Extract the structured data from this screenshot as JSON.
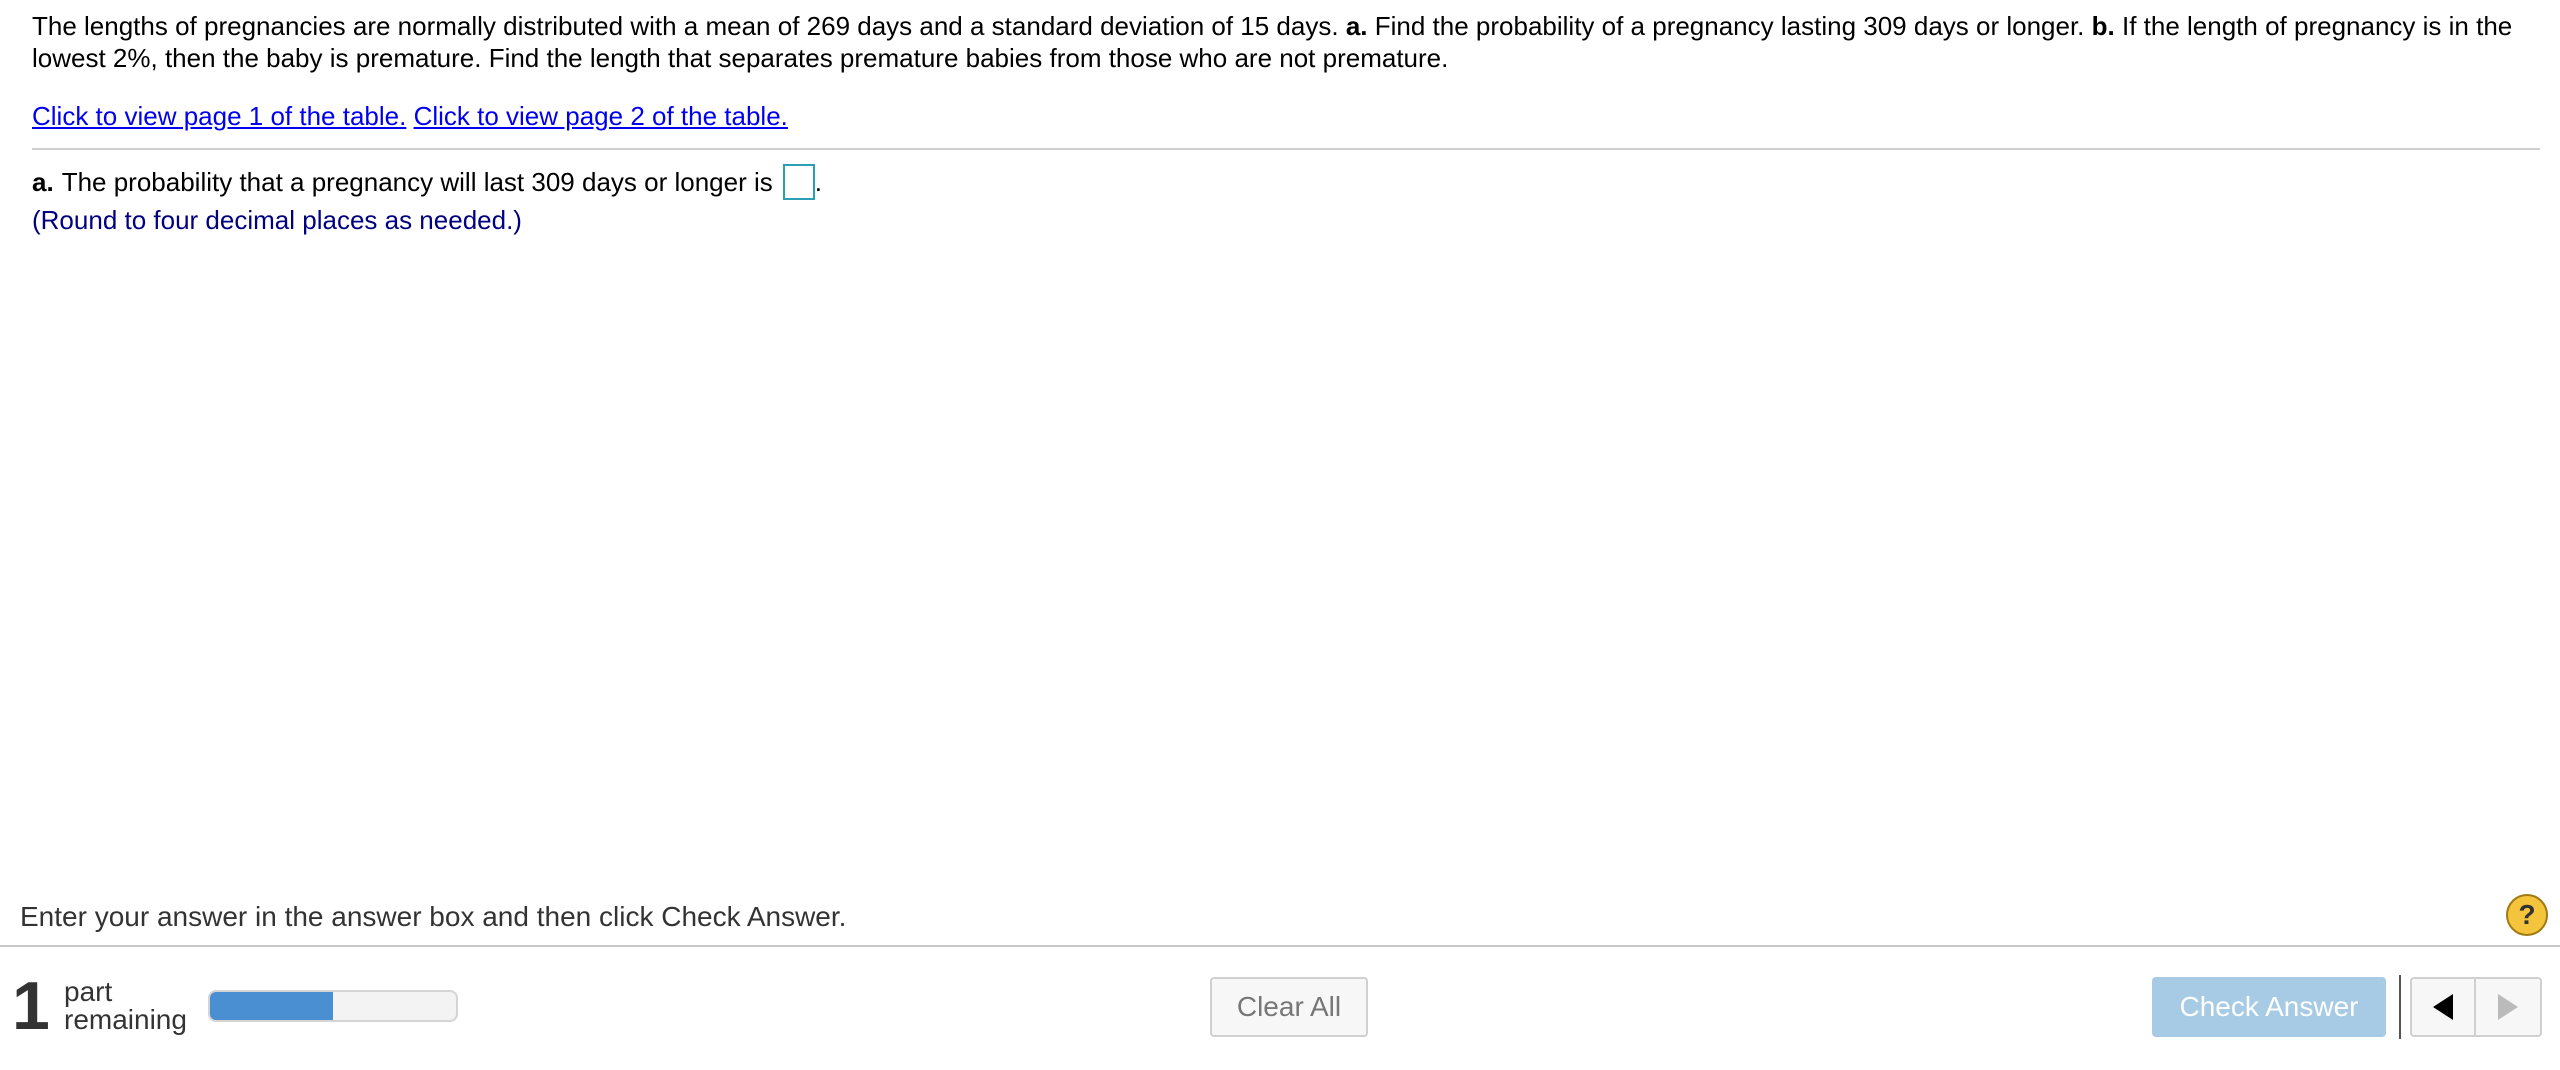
{
  "question": {
    "part1": "The lengths of pregnancies are normally distributed with a mean of 269 days and a standard deviation of 15 days.",
    "label_a": "a.",
    "part2": "Find the probability of a pregnancy lasting 309 days or longer.",
    "label_b": "b.",
    "part3": "If the length of pregnancy is in the lowest 2%, then the baby is premature. Find the length that separates premature babies from those who are not premature."
  },
  "links": {
    "table_page1": "Click to view page 1 of the table.",
    "table_page2": "Click to view page 2 of the table."
  },
  "part_a": {
    "label": "a.",
    "text": "The probability that a pregnancy will last 309 days or longer is",
    "answer_value": "",
    "trailing": ".",
    "note": "(Round to four decimal places as needed.)"
  },
  "footer": {
    "instruction": "Enter your answer in the answer box and then click Check Answer.",
    "help_symbol": "?",
    "parts_count": "1",
    "parts_word": "part",
    "parts_remaining": "remaining",
    "progress_fraction": 0.5,
    "clear_all_label": "Clear All",
    "check_answer_label": "Check Answer"
  },
  "colors": {
    "link": "#0000ee",
    "note": "#000080",
    "progress_fill": "#4a8fd1",
    "check_button": "#a7cbe5",
    "answer_box_border": "#2aa0b5",
    "help_icon": "#f5c43d"
  },
  "icons": {
    "help": "help-question-icon",
    "prev": "triangle-left-icon",
    "next": "triangle-right-icon"
  }
}
